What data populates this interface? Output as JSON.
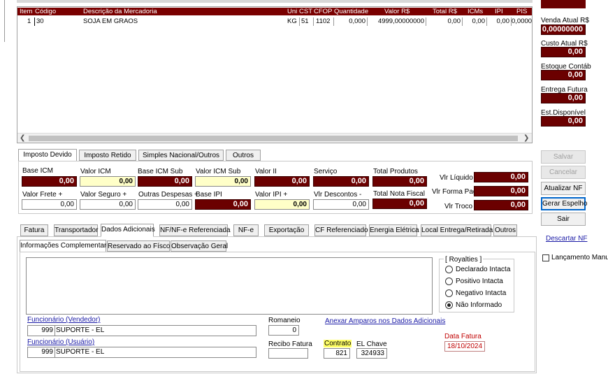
{
  "grid": {
    "columns": [
      "Item",
      "Código",
      "Descrição da Mercadoria",
      "Uni",
      "CST",
      "CFOP",
      "Quantidade",
      "Valor R$",
      "Total R$",
      "ICMs",
      "IPI",
      "PIS"
    ],
    "row": {
      "item": "1",
      "codigo": "30",
      "descricao": "SOJA EM GRAOS",
      "uni": "KG",
      "cst": "51",
      "cfop": "1102",
      "quantidade": "0,000",
      "valor": "4999,00000000",
      "total": "0,00",
      "icms": "0,00",
      "ipi": "0,00",
      "pis": "0,0000"
    }
  },
  "side": {
    "venda_label": "Venda Atual R$",
    "venda_value": "0,00000000",
    "custo_label": "Custo Atual R$",
    "custo_value": "0,00",
    "estoque_label": "Estoque Contáb",
    "estoque_value": "0,00",
    "entrega_label": "Entrega Futura",
    "entrega_value": "0,00",
    "disponivel_label": "Est.Disponível",
    "disponivel_value": "0,00",
    "salvar": "Salvar",
    "cancelar": "Cancelar",
    "atualizar": "Atualizar NF",
    "gerar": "Gerar Espelho",
    "sair": "Sair",
    "descartar": "Descartar NF",
    "lancamento": "Lançamento Manual"
  },
  "imposto_tabs": [
    "Imposto Devido",
    "Imposto Retido",
    "Simples Nacional/Outros",
    "Outros"
  ],
  "imposto": {
    "base_icm_l": "Base ICM",
    "base_icm": "0,00",
    "valor_icm_l": "Valor ICM",
    "valor_icm": "0,00",
    "base_icm_sub_l": "Base ICM Sub",
    "base_icm_sub": "0,00",
    "valor_icm_sub_l": "Valor ICM Sub",
    "valor_icm_sub": "0,00",
    "valor_ii_l": "Valor II",
    "valor_ii": "0,00",
    "servico_l": "Serviço",
    "servico": "0,00",
    "total_produtos_l": "Total Produtos",
    "total_produtos": "0,00",
    "vlr_liquido_l": "Vlr Líquido",
    "vlr_liquido": "0,00",
    "valor_frete_l": "Valor Frete +",
    "valor_frete": "0,00",
    "valor_seguro_l": "Valor Seguro +",
    "valor_seguro": "0,00",
    "outras_l": "Outras Despesas +",
    "outras": "0,00",
    "base_ipi_l": "Base IPI",
    "base_ipi": "0,00",
    "valor_ipi_l": "Valor IPI +",
    "valor_ipi": "0,00",
    "vlr_desc_l": "Vlr Descontos -",
    "vlr_desc": "0,00",
    "total_nf_l": "Total Nota Fiscal",
    "total_nf": "0,00",
    "vlr_forma_l": "Vlr Forma Pag",
    "vlr_forma": "0,00",
    "vlr_troco_l": "Vlr Troco",
    "vlr_troco": "0,00"
  },
  "main_tabs": [
    "Fatura",
    "Transportador",
    "Dados Adicionais",
    "NF/NF-e Referenciada",
    "NF-e",
    "Exportação",
    "CF Referenciado",
    "Energia Elétrica",
    "Local Entrega/Retirada",
    "Outros"
  ],
  "sub_tabs": [
    "Informações Complementares",
    "Reservado ao Físco",
    "Observação Geral"
  ],
  "royalties": {
    "title": "Royalties",
    "options": [
      "Declarado Intacta",
      "Positivo Intacta",
      "Negativo Intacta",
      "Não Informado"
    ],
    "selected": 3
  },
  "dados": {
    "func_vendedor_l": "Funcionário (Vendedor)",
    "func_vendedor_code": "999",
    "func_vendedor_name": "SUPORTE - EL",
    "func_usuario_l": "Funcionário (Usuário)",
    "func_usuario_code": "999",
    "func_usuario_name": "SUPORTE - EL",
    "romaneio_l": "Romaneio",
    "romaneio": "0",
    "anexar": "Anexar Amparos nos Dados Adicionais",
    "recibo_l": "Recibo Fatura",
    "recibo": "",
    "contrato_l": "Contrato",
    "contrato": "821",
    "el_chave_l": "EL Chave",
    "el_chave": "324933",
    "data_fatura_l": "Data Fatura",
    "data_fatura": "18/10/2024"
  }
}
